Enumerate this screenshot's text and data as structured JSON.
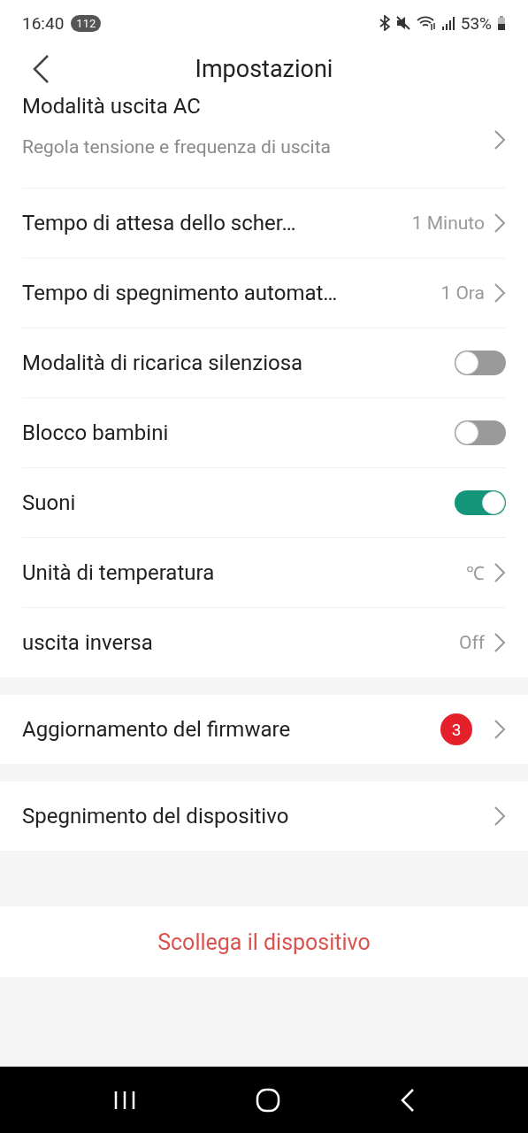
{
  "status_bar": {
    "time": "16:40",
    "notification_count": "112",
    "battery": "53%"
  },
  "header": {
    "title": "Impostazioni"
  },
  "groups": [
    {
      "rows": [
        {
          "kind": "link",
          "label": "Modalità uscita AC",
          "subtitle": "Regola tensione e frequenza di uscita"
        },
        {
          "kind": "link",
          "label": "Tempo di attesa dello scher…",
          "value": "1 Minuto"
        },
        {
          "kind": "link",
          "label": "Tempo di spegnimento automat…",
          "value": "1 Ora"
        },
        {
          "kind": "toggle",
          "label": "Modalità di ricarica silenziosa",
          "on": false
        },
        {
          "kind": "toggle",
          "label": "Blocco bambini",
          "on": false
        },
        {
          "kind": "toggle",
          "label": "Suoni",
          "on": true
        },
        {
          "kind": "link",
          "label": "Unità di temperatura",
          "value": "℃"
        },
        {
          "kind": "link",
          "label": "uscita inversa",
          "value": "Off"
        }
      ]
    },
    {
      "rows": [
        {
          "kind": "link",
          "label": "Aggiornamento del firmware",
          "badge": "3"
        }
      ]
    },
    {
      "rows": [
        {
          "kind": "link",
          "label": "Spegnimento del dispositivo"
        }
      ]
    }
  ],
  "disconnect_button": "Scollega il dispositivo"
}
